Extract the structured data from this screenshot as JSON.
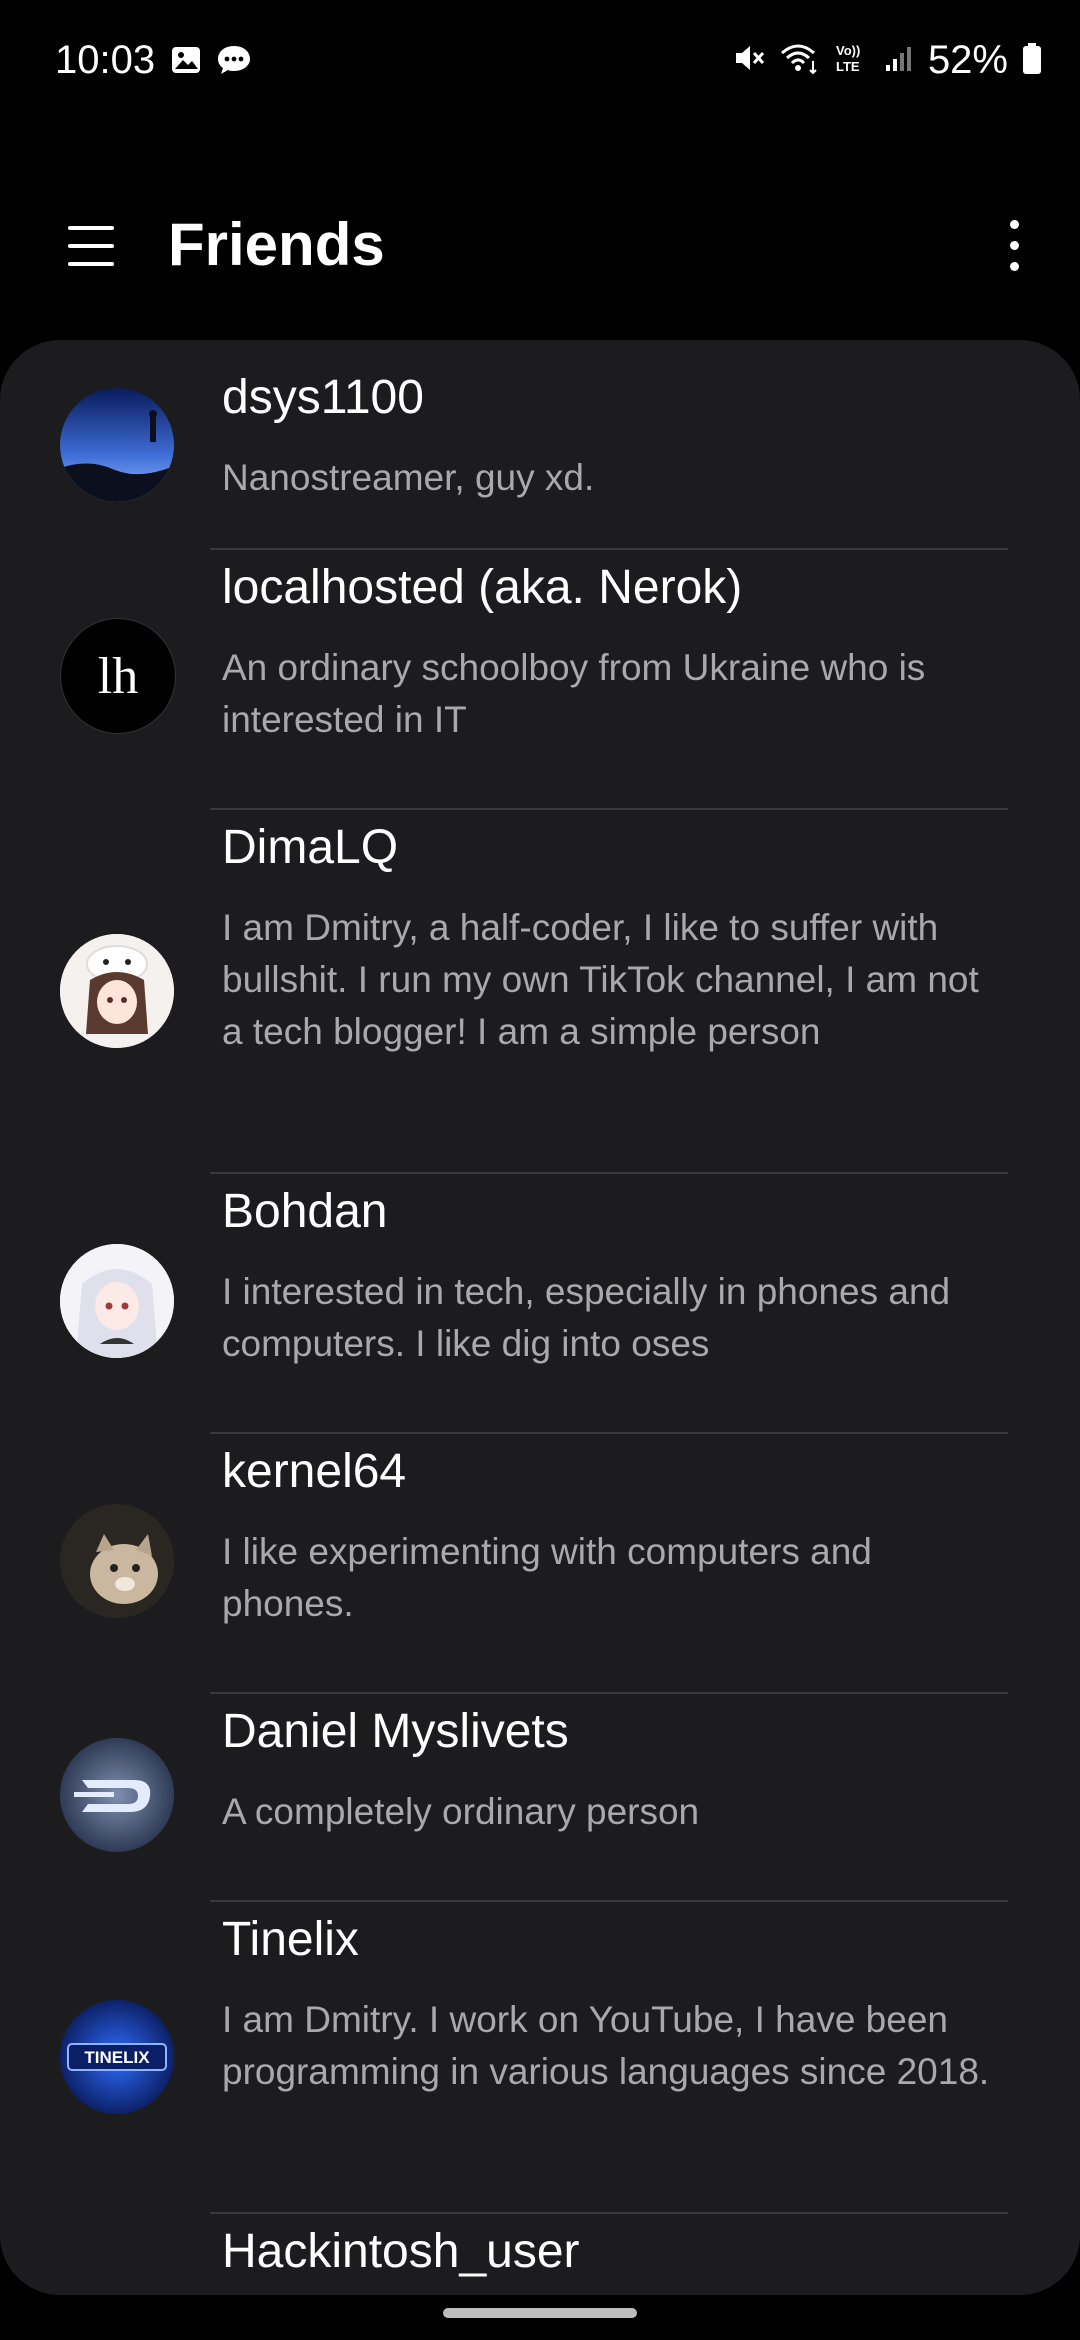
{
  "status_bar": {
    "time": "10:03",
    "battery": "52%",
    "icons": [
      "gallery-icon",
      "chat-bubble-icon",
      "mute-icon",
      "wifi-icon",
      "volte-icon",
      "signal-icon",
      "battery-icon"
    ]
  },
  "header": {
    "title": "Friends"
  },
  "friends": [
    {
      "name": "dsys1100",
      "description": "Nanostreamer, guy xd."
    },
    {
      "name": "localhosted (aka. Nerok)",
      "description": "An ordinary schoolboy from Ukraine who is interested in IT"
    },
    {
      "name": "DimaLQ",
      "description": "I am Dmitry, a half-coder, I like to suffer with bullshit. I run my own TikTok channel, I am not a tech blogger! I am a simple person"
    },
    {
      "name": "Bohdan",
      "description": "I interested in tech, especially in phones and computers. I like dig into oses"
    },
    {
      "name": "kernel64",
      "description": "I like experimenting with computers and phones."
    },
    {
      "name": "Daniel Myslivets",
      "description": "A completely ordinary person"
    },
    {
      "name": "Tinelix",
      "description": "I am Dmitry. I work on YouTube, I have been programming in various languages since 2018."
    },
    {
      "name": "Hackintosh_user",
      "description": ""
    }
  ],
  "avatar_labels": {
    "localhosted": "lh",
    "tinelix": "TINELIX"
  }
}
